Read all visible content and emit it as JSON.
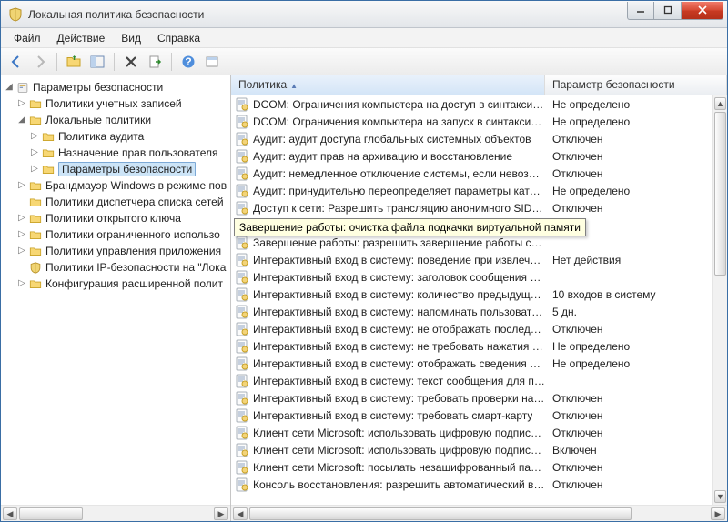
{
  "window": {
    "title": "Локальная политика безопасности"
  },
  "menu": {
    "file": "Файл",
    "action": "Действие",
    "view": "Вид",
    "help": "Справка"
  },
  "tree": {
    "root": "Параметры безопасности",
    "n1": "Политики учетных записей",
    "n2": "Локальные политики",
    "n2a": "Политика аудита",
    "n2b": "Назначение прав пользователя",
    "n2c": "Параметры безопасности",
    "n3": "Брандмауэр Windows в режиме пов",
    "n4": "Политики диспетчера списка сетей",
    "n5": "Политики открытого ключа",
    "n6": "Политики ограниченного использо",
    "n7": "Политики управления приложения",
    "n8": "Политики IP-безопасности на \"Лока",
    "n9": "Конфигурация расширенной полит"
  },
  "columns": {
    "policy": "Политика",
    "param": "Параметр безопасности"
  },
  "tooltip": "Завершение работы: очистка файла подкачки виртуальной памяти",
  "rows": [
    {
      "p": "DCOM: Ограничения компьютера на доступ в синтаксис...",
      "v": "Не определено"
    },
    {
      "p": "DCOM: Ограничения компьютера на запуск в синтаксис...",
      "v": "Не определено"
    },
    {
      "p": "Аудит: аудит доступа глобальных системных объектов",
      "v": "Отключен"
    },
    {
      "p": "Аудит: аудит прав на архивацию и восстановление",
      "v": "Отключен"
    },
    {
      "p": "Аудит: немедленное отключение системы, если невозмо...",
      "v": "Отключен"
    },
    {
      "p": "Аудит: принудительно переопределяет параметры катег...",
      "v": "Не определено"
    },
    {
      "p": "Доступ к сети: Разрешить трансляцию анонимного SID в ...",
      "v": "Отключен"
    },
    {
      "p": "Завершение работы: очистка файла подкачки виртуальн...",
      "v": "ен"
    },
    {
      "p": "Завершение работы: разрешить завершение работы сис...",
      "v": ""
    },
    {
      "p": "Интерактивный вход в систему:  поведение при извлечен...",
      "v": "Нет действия"
    },
    {
      "p": "Интерактивный вход в систему: заголовок сообщения дл...",
      "v": ""
    },
    {
      "p": "Интерактивный вход в систему: количество предыдущих ...",
      "v": "10 входов в систему"
    },
    {
      "p": "Интерактивный вход в систему: напоминать пользовател...",
      "v": "5 дн."
    },
    {
      "p": "Интерактивный вход в систему: не отображать последне...",
      "v": "Отключен"
    },
    {
      "p": "Интерактивный вход в систему: не требовать нажатия CT...",
      "v": "Не определено"
    },
    {
      "p": "Интерактивный вход в систему: отображать сведения о п...",
      "v": "Не определено"
    },
    {
      "p": "Интерактивный вход в систему: текст сообщения для по...",
      "v": ""
    },
    {
      "p": "Интерактивный вход в систему: требовать проверки на к...",
      "v": "Отключен"
    },
    {
      "p": "Интерактивный вход в систему: требовать смарт-карту",
      "v": "Отключен"
    },
    {
      "p": "Клиент сети Microsoft: использовать цифровую подпись ...",
      "v": "Отключен"
    },
    {
      "p": "Клиент сети Microsoft: использовать цифровую подпись ...",
      "v": "Включен"
    },
    {
      "p": "Клиент сети Microsoft: посылать незашифрованный пар...",
      "v": "Отключен"
    },
    {
      "p": "Консоль восстановления: разрешить автоматический вх...",
      "v": "Отключен"
    }
  ]
}
